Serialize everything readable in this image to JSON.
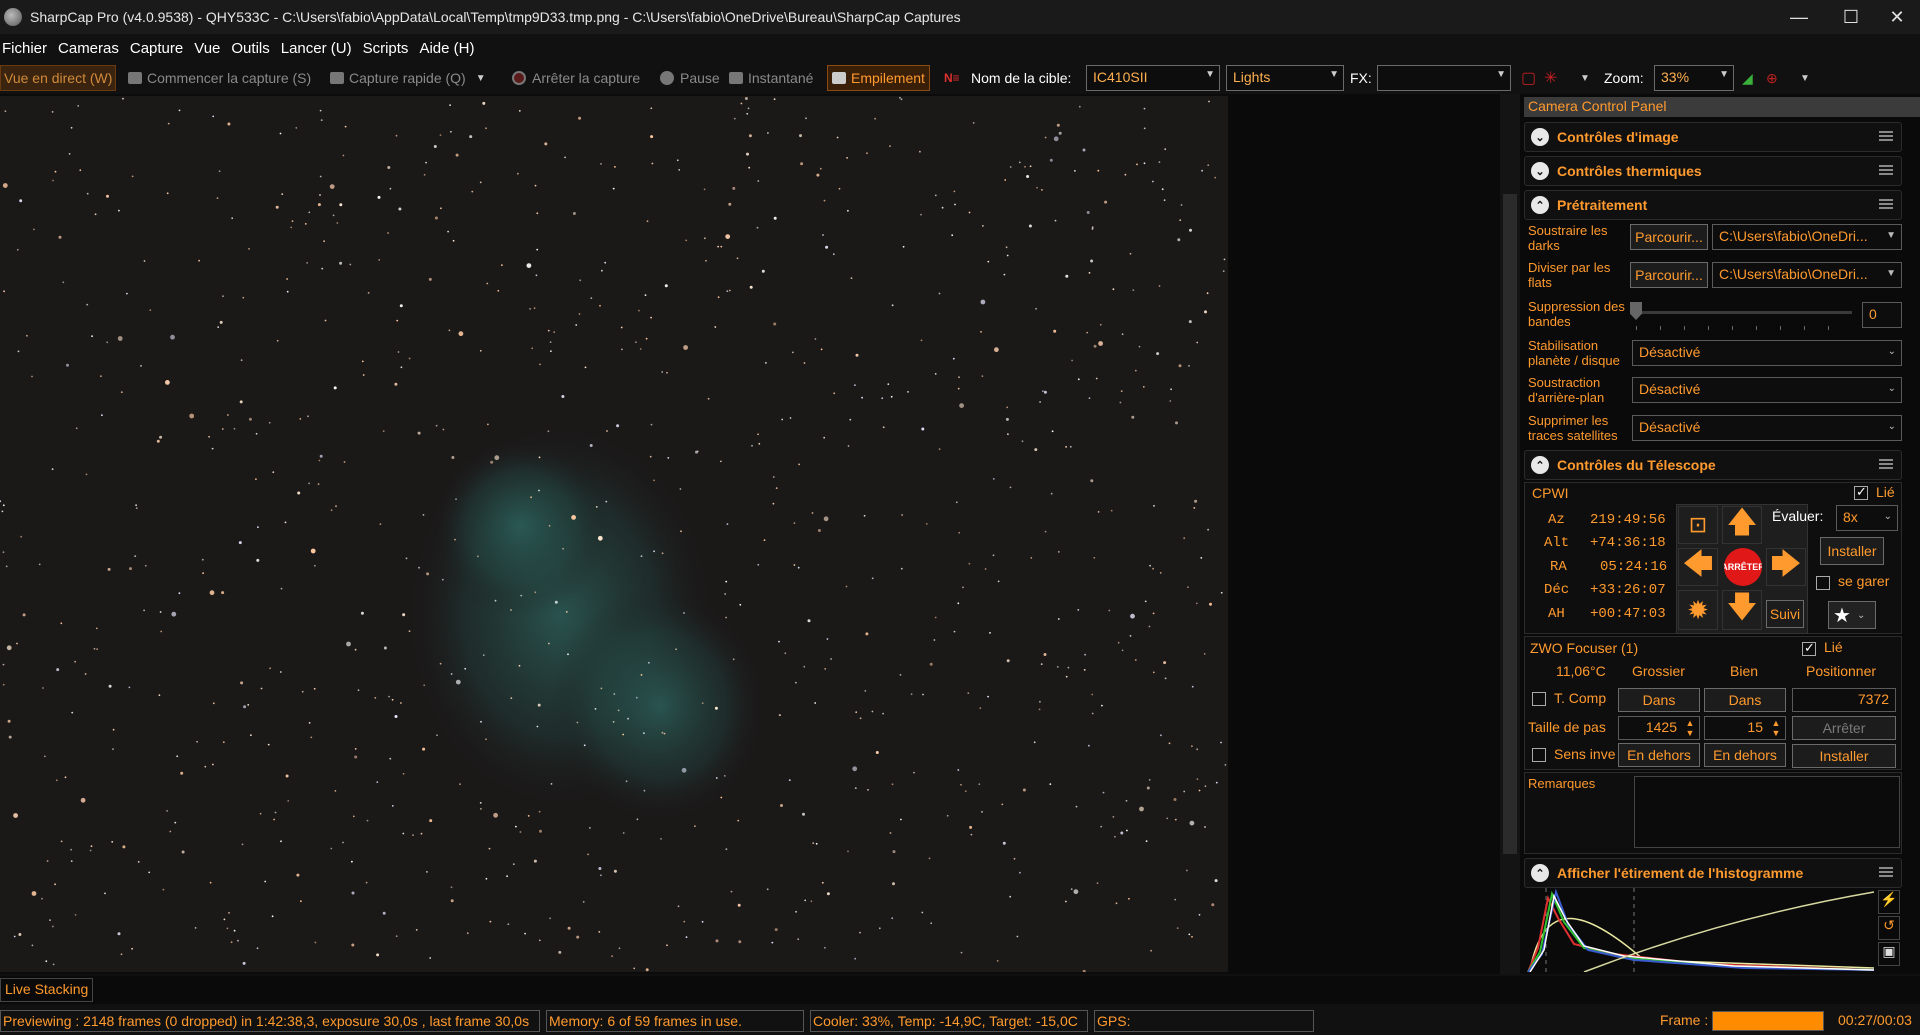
{
  "window": {
    "title": "SharpCap Pro (v4.0.9538) - QHY533C - C:\\Users\\fabio\\AppData\\Local\\Temp\\tmp9D33.tmp.png - C:\\Users\\fabio\\OneDrive\\Bureau\\SharpCap Captures",
    "minimize": "—",
    "maximize": "☐",
    "close": "✕"
  },
  "menu": [
    "Fichier",
    "Cameras",
    "Capture",
    "Vue",
    "Outils",
    "Lancer (U)",
    "Scripts",
    "Aide (H)"
  ],
  "toolbar": {
    "live_view": "Vue en direct (W)",
    "start_capture": "Commencer la capture (S)",
    "quick_capture": "Capture rapide (Q)",
    "stop_capture": "Arrêter la capture",
    "pause": "Pause",
    "snapshot": "Instantané",
    "stacking": "Empilement",
    "target_label": "Nom de la cible:",
    "target_value": "IC410SII",
    "frame_type": "Lights",
    "fx_label": "FX:",
    "fx_value": "",
    "zoom_label": "Zoom:",
    "zoom_value": "33%"
  },
  "panel": {
    "title": "Camera Control Panel",
    "sections": {
      "image_controls": "Contrôles d'image",
      "thermal_controls": "Contrôles thermiques",
      "preprocessing": "Prétraitement",
      "telescope": "Contrôles du Télescope",
      "histogram": "Afficher l'étirement de l'histogramme"
    },
    "preprocessing": {
      "darks_label": "Soustraire les darks",
      "darks_browse": "Parcourir...",
      "darks_path": "C:\\Users\\fabio\\OneDri...",
      "flats_label": "Diviser par les flats",
      "flats_browse": "Parcourir...",
      "flats_path": "C:\\Users\\fabio\\OneDri...",
      "banding_label": "Suppression des bandes",
      "banding_value": "0",
      "stabilization_label": "Stabilisation planète / disque",
      "stabilization_value": "Désactivé",
      "background_label": "Soustraction d'arrière-plan",
      "background_value": "Désactivé",
      "satellite_label": "Supprimer les traces satellites",
      "satellite_value": "Désactivé"
    },
    "telescope": {
      "name": "CPWI",
      "linked_label": "Lié",
      "rate_label": "Évaluer:",
      "rate_value": "8x",
      "install": "Installer",
      "park": "se garer",
      "stop": "ARRÊTER",
      "track": "Suivi",
      "coords": [
        {
          "k": "Az",
          "v": "219:49:56"
        },
        {
          "k": "Alt",
          "v": "+74:36:18"
        },
        {
          "k": "RA",
          "v": "05:24:16"
        },
        {
          "k": "Déc",
          "v": "+33:26:07"
        },
        {
          "k": "AH",
          "v": "+00:47:03"
        }
      ]
    },
    "focuser": {
      "name": "ZWO Focuser (1)",
      "linked_label": "Lié",
      "temp": "11,06°C",
      "coarse": "Grossier",
      "fine": "Bien",
      "position_label": "Positionner",
      "tcomp": "T. Comp",
      "in_coarse": "Dans",
      "in_fine": "Dans",
      "position_value": "7372",
      "step_label": "Taille de pas",
      "step_coarse": "1425",
      "step_fine": "15",
      "stop": "Arrêter",
      "reverse": "Sens inverse",
      "out_coarse": "En dehors",
      "out_fine": "En dehors",
      "install": "Installer"
    },
    "notes_label": "Remarques"
  },
  "live_stacking": "Live Stacking",
  "status": {
    "preview": "Previewing : 2148 frames (0 dropped) in 1:42:38,3, exposure 30,0s , last frame 30,0s",
    "memory": "Memory: 6 of 59 frames in use.",
    "cooler": "Cooler: 33%, Temp: -14,9C, Target: -15,0C",
    "gps": "GPS:",
    "frame_label": "Frame :",
    "frame_time": "00:27/00:03"
  },
  "colors": {
    "accent": "#ff9a2e",
    "panel_bg": "#101010"
  }
}
